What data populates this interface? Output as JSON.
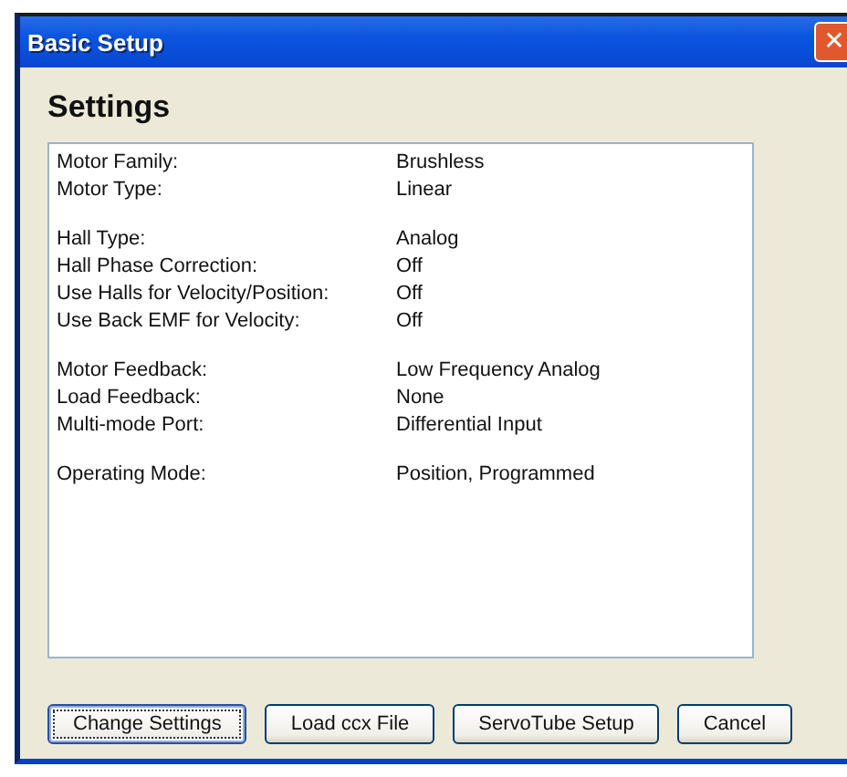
{
  "window": {
    "title": "Basic Setup",
    "close": "✕"
  },
  "heading": "Settings",
  "groups": [
    {
      "rows": [
        {
          "label": "Motor Family:",
          "value": "Brushless"
        },
        {
          "label": "Motor Type:",
          "value": "Linear"
        }
      ]
    },
    {
      "rows": [
        {
          "label": "Hall Type:",
          "value": "Analog"
        },
        {
          "label": "Hall Phase Correction:",
          "value": "Off"
        },
        {
          "label": "Use Halls for Velocity/Position:",
          "value": "Off"
        },
        {
          "label": "Use Back EMF for Velocity:",
          "value": "Off"
        }
      ]
    },
    {
      "rows": [
        {
          "label": "Motor Feedback:",
          "value": "Low Frequency Analog"
        },
        {
          "label": "Load Feedback:",
          "value": "None"
        },
        {
          "label": "Multi-mode Port:",
          "value": "Differential Input"
        }
      ]
    },
    {
      "rows": [
        {
          "label": "Operating Mode:",
          "value": "Position, Programmed"
        }
      ]
    }
  ],
  "buttons": [
    {
      "label": "Change Settings",
      "focused": true
    },
    {
      "label": "Load ccx File",
      "focused": false
    },
    {
      "label": "ServoTube Setup",
      "focused": false
    },
    {
      "label": "Cancel",
      "focused": false
    }
  ]
}
